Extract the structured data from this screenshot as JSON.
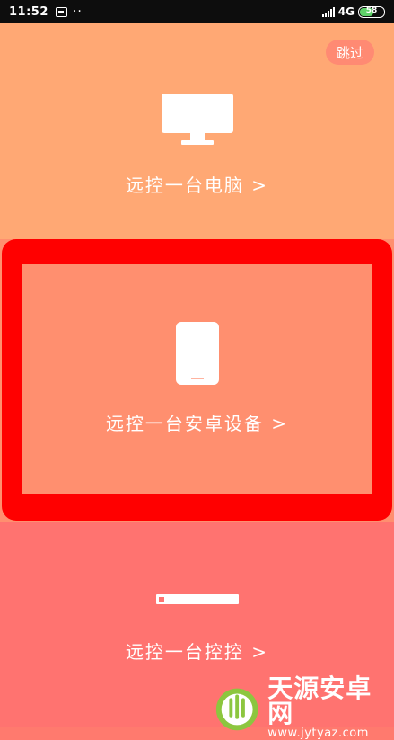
{
  "status_bar": {
    "time": "11:52",
    "dots": "··",
    "network": "4G",
    "battery": "58"
  },
  "skip_label": "跳过",
  "options": [
    {
      "label": "远控一台电脑 >",
      "icon": "monitor-icon"
    },
    {
      "label": "远控一台安卓设备 >",
      "icon": "phone-icon"
    },
    {
      "label": "远控一台控控 >",
      "icon": "device-bar-icon"
    }
  ],
  "watermark": {
    "name": "天源安卓网",
    "url": "www.jytyaz.com"
  },
  "colors": {
    "top_panel": "#ffa874",
    "middle_panel": "#ff8f6f",
    "bottom_panel": "#ff7370",
    "highlight": "#ff0000"
  }
}
